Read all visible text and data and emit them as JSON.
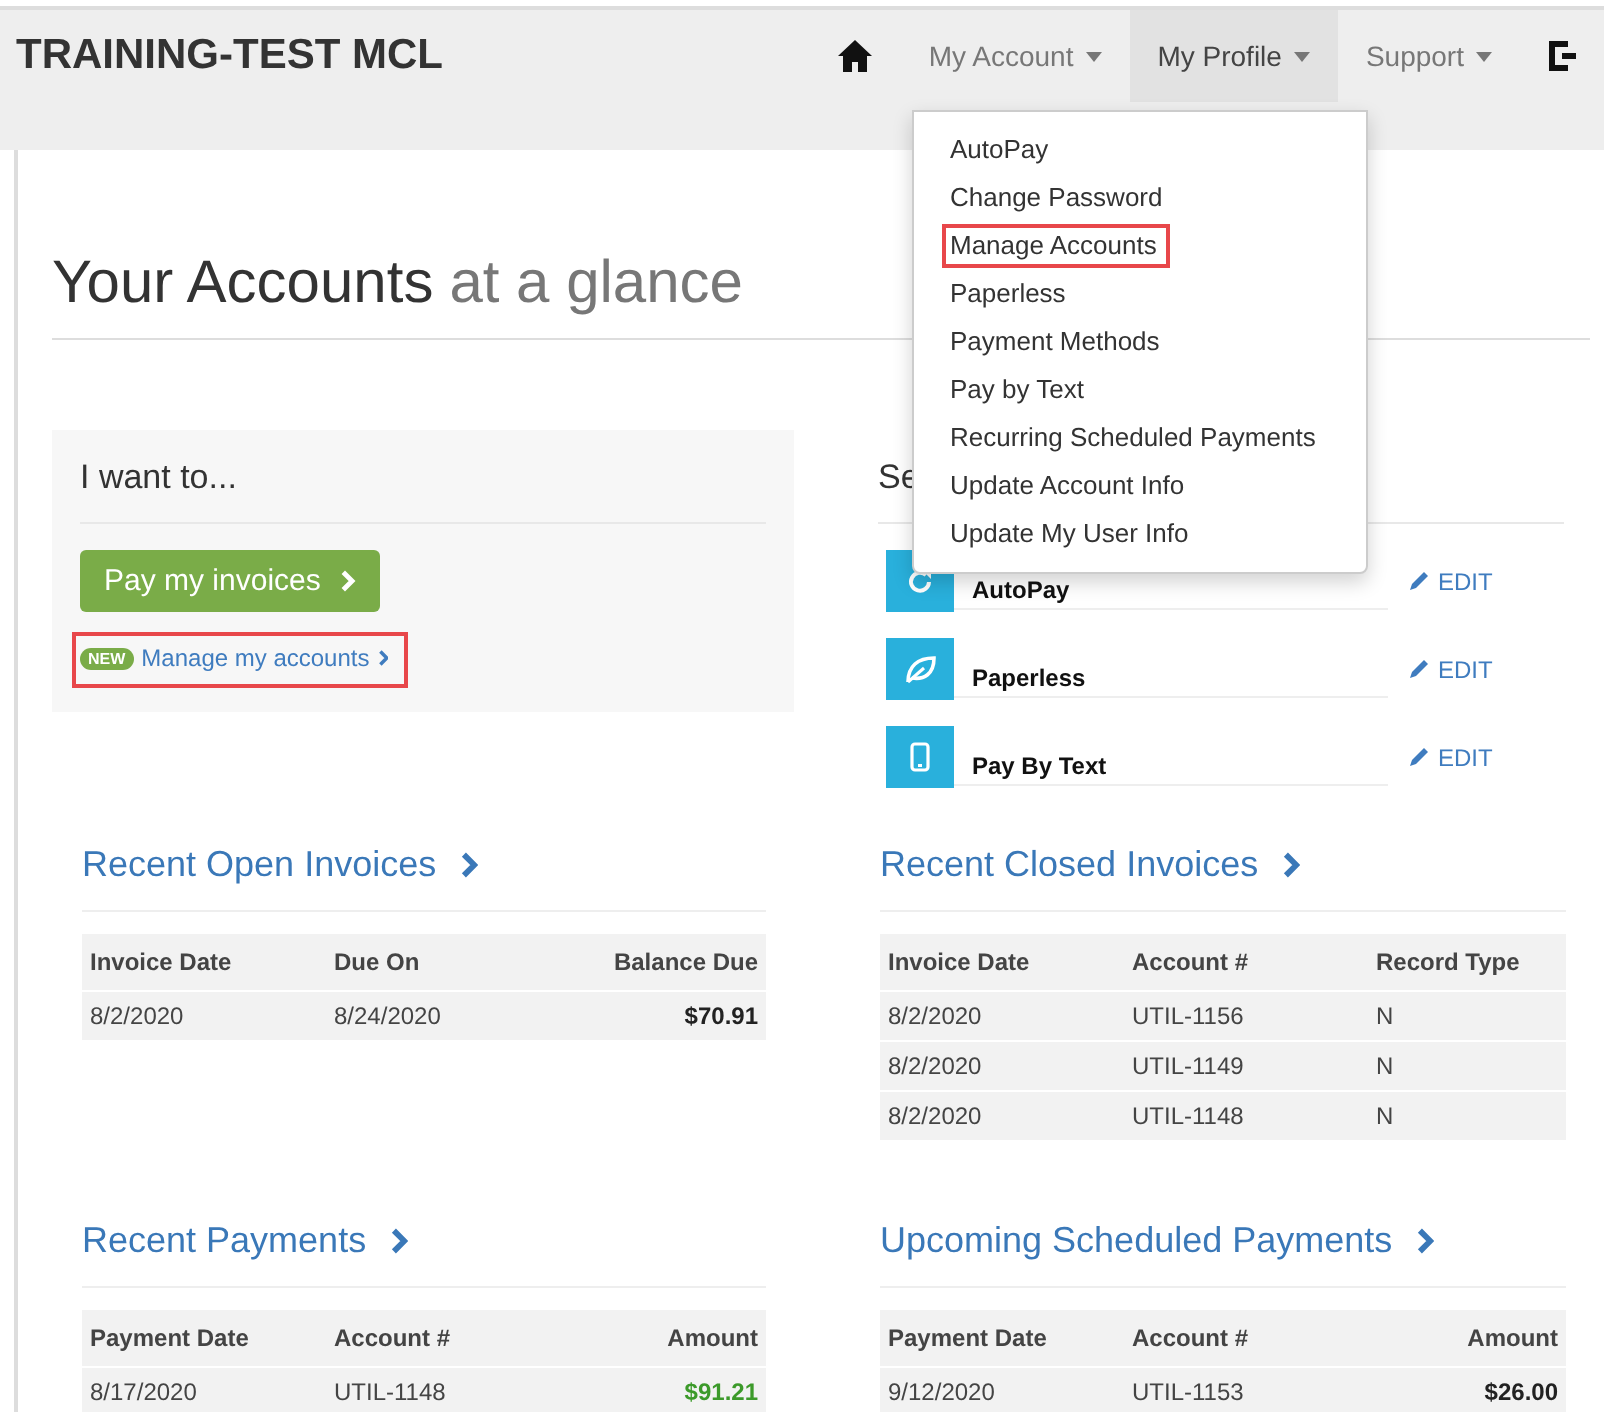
{
  "header": {
    "brand": "TRAINING-TEST MCL",
    "nav": [
      {
        "kind": "home",
        "selected": false
      },
      {
        "kind": "menu",
        "label": "My Account",
        "selected": false
      },
      {
        "kind": "menu",
        "label": "My Profile",
        "selected": true
      },
      {
        "kind": "menu",
        "label": "Support",
        "selected": false
      },
      {
        "kind": "logout",
        "selected": false
      }
    ]
  },
  "dropdown": {
    "items": [
      {
        "label": "AutoPay",
        "highlighted": false
      },
      {
        "label": "Change Password",
        "highlighted": false
      },
      {
        "label": "Manage Accounts",
        "highlighted": true
      },
      {
        "label": "Paperless",
        "highlighted": false
      },
      {
        "label": "Payment Methods",
        "highlighted": false
      },
      {
        "label": "Pay by Text",
        "highlighted": false
      },
      {
        "label": "Recurring Scheduled Payments",
        "highlighted": false
      },
      {
        "label": "Update Account Info",
        "highlighted": false
      },
      {
        "label": "Update My User Info",
        "highlighted": false
      }
    ]
  },
  "page_title": {
    "main": "Your Accounts",
    "accent": "at a glance"
  },
  "want_panel": {
    "title": "I want to...",
    "button": "Pay my invoices",
    "link": {
      "badge": "NEW",
      "label": "Manage my accounts",
      "highlighted": true
    }
  },
  "settings_panel": {
    "title": "Se",
    "rows": [
      {
        "kind": "autopay",
        "label": "AutoPay",
        "action": "EDIT"
      },
      {
        "kind": "paperless",
        "label": "Paperless",
        "action": "EDIT"
      },
      {
        "kind": "text",
        "label": "Pay By Text",
        "action": "EDIT"
      }
    ]
  },
  "sections": [
    {
      "title": "Recent Open Invoices",
      "columns": [
        {
          "label": "Invoice Date",
          "right": false
        },
        {
          "label": "Due On",
          "right": false
        },
        {
          "label": "Balance Due",
          "right": true
        }
      ],
      "rows": [
        {
          "cells": [
            "8/2/2020",
            "8/24/2020",
            "$70.91"
          ],
          "paid": false
        }
      ]
    },
    {
      "title": "Recent Closed Invoices",
      "columns": [
        {
          "label": "Invoice Date",
          "right": false
        },
        {
          "label": "Account #",
          "right": false
        },
        {
          "label": "Record Type",
          "right": false
        }
      ],
      "rows": [
        {
          "cells": [
            "8/2/2020",
            "UTIL-1156",
            "N"
          ]
        },
        {
          "cells": [
            "8/2/2020",
            "UTIL-1149",
            "N"
          ]
        },
        {
          "cells": [
            "8/2/2020",
            "UTIL-1148",
            "N"
          ]
        }
      ]
    },
    {
      "title": "Recent Payments",
      "columns": [
        {
          "label": "Payment Date",
          "right": false
        },
        {
          "label": "Account #",
          "right": false
        },
        {
          "label": "Amount",
          "right": true
        }
      ],
      "rows": [
        {
          "cells": [
            "8/17/2020",
            "UTIL-1148",
            "$91.21"
          ],
          "paid": true
        }
      ]
    },
    {
      "title": "Upcoming Scheduled Payments",
      "columns": [
        {
          "label": "Payment Date",
          "right": false
        },
        {
          "label": "Account #",
          "right": false
        },
        {
          "label": "Amount",
          "right": true
        }
      ],
      "rows": [
        {
          "cells": [
            "9/12/2020",
            "UTIL-1153",
            "$26.00"
          ],
          "paid": false
        }
      ]
    }
  ]
}
